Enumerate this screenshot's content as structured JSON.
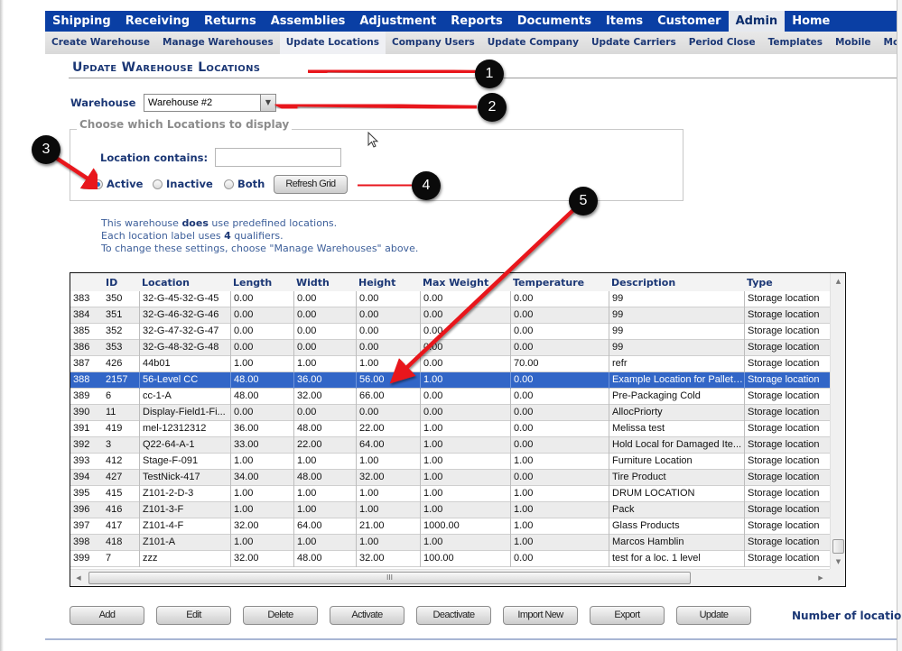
{
  "main_nav": [
    {
      "label": "Shipping",
      "active": false
    },
    {
      "label": "Receiving",
      "active": false
    },
    {
      "label": "Returns",
      "active": false
    },
    {
      "label": "Assemblies",
      "active": false
    },
    {
      "label": "Adjustment",
      "active": false
    },
    {
      "label": "Reports",
      "active": false
    },
    {
      "label": "Documents",
      "active": false
    },
    {
      "label": "Items",
      "active": false
    },
    {
      "label": "Customer",
      "active": false
    },
    {
      "label": "Admin",
      "active": true
    },
    {
      "label": "Home",
      "active": false
    }
  ],
  "sub_nav": [
    {
      "label": "Create Warehouse",
      "active": false
    },
    {
      "label": "Manage Warehouses",
      "active": false
    },
    {
      "label": "Update Locations",
      "active": true
    },
    {
      "label": "Company Users",
      "active": false
    },
    {
      "label": "Update Company",
      "active": false
    },
    {
      "label": "Update Carriers",
      "active": false
    },
    {
      "label": "Period Close",
      "active": false
    },
    {
      "label": "Templates",
      "active": false
    },
    {
      "label": "Mobile",
      "active": false
    },
    {
      "label": "Movab",
      "active": false
    }
  ],
  "page_title": "Update Warehouse Locations",
  "warehouse": {
    "label": "Warehouse",
    "selected": "Warehouse #2",
    "dropdown_glyph": "▼"
  },
  "filter": {
    "legend": "Choose which Locations to display",
    "location_contains_label": "Location contains:",
    "location_contains_value": "",
    "radios": [
      {
        "label": "Active",
        "checked": true
      },
      {
        "label": "Inactive",
        "checked": false
      },
      {
        "label": "Both",
        "checked": false
      }
    ],
    "refresh_label": "Refresh Grid"
  },
  "info": {
    "line1_pre": "This warehouse ",
    "line1_bold": "does",
    "line1_post": " use predefined locations.",
    "line2_pre": "Each location label uses ",
    "line2_bold": "4",
    "line2_post": " qualifiers.",
    "line3": "To change these settings, choose \"Manage Warehouses\" above."
  },
  "grid": {
    "columns": [
      "",
      "ID",
      "Location",
      "Length",
      "Width",
      "Height",
      "Max Weight",
      "Temperature",
      "Description",
      "Type"
    ],
    "selected_row_index": 5,
    "rows": [
      [
        "383",
        "350",
        "32-G-45-32-G-45",
        "0.00",
        "0.00",
        "0.00",
        "0.00",
        "0.00",
        "99",
        "Storage location"
      ],
      [
        "384",
        "351",
        "32-G-46-32-G-46",
        "0.00",
        "0.00",
        "0.00",
        "0.00",
        "0.00",
        "99",
        "Storage location"
      ],
      [
        "385",
        "352",
        "32-G-47-32-G-47",
        "0.00",
        "0.00",
        "0.00",
        "0.00",
        "0.00",
        "99",
        "Storage location"
      ],
      [
        "386",
        "353",
        "32-G-48-32-G-48",
        "0.00",
        "0.00",
        "0.00",
        "0.00",
        "0.00",
        "99",
        "Storage location"
      ],
      [
        "387",
        "426",
        "44b01",
        "1.00",
        "1.00",
        "1.00",
        "0.00",
        "70.00",
        "refr",
        "Storage location"
      ],
      [
        "388",
        "2157",
        "56-Level CC",
        "48.00",
        "36.00",
        "56.00",
        "1.00",
        "0.00",
        "Example Location for Pallet ...",
        "Storage location"
      ],
      [
        "389",
        "6",
        "cc-1-A",
        "48.00",
        "32.00",
        "66.00",
        "0.00",
        "0.00",
        "Pre-Packaging Cold",
        "Storage location"
      ],
      [
        "390",
        "11",
        "Display-Field1-Fi...",
        "0.00",
        "0.00",
        "0.00",
        "0.00",
        "0.00",
        "AllocPriorty",
        "Storage location"
      ],
      [
        "391",
        "419",
        "mel-12312312",
        "36.00",
        "48.00",
        "22.00",
        "1.00",
        "0.00",
        "Melissa test",
        "Storage location"
      ],
      [
        "392",
        "3",
        "Q22-64-A-1",
        "33.00",
        "22.00",
        "64.00",
        "1.00",
        "0.00",
        "Hold Local for Damaged Ite...",
        "Storage location"
      ],
      [
        "393",
        "412",
        "Stage-F-091",
        "1.00",
        "1.00",
        "1.00",
        "1.00",
        "1.00",
        "Furniture Location",
        "Storage location"
      ],
      [
        "394",
        "427",
        "TestNick-417",
        "34.00",
        "48.00",
        "32.00",
        "1.00",
        "0.00",
        "Tire Product",
        "Storage location"
      ],
      [
        "395",
        "415",
        "Z101-2-D-3",
        "1.00",
        "1.00",
        "1.00",
        "1.00",
        "1.00",
        "DRUM LOCATION",
        "Storage location"
      ],
      [
        "396",
        "416",
        "Z101-3-F",
        "1.00",
        "1.00",
        "1.00",
        "1.00",
        "1.00",
        "Pack",
        "Storage location"
      ],
      [
        "397",
        "417",
        "Z101-4-F",
        "32.00",
        "64.00",
        "21.00",
        "1000.00",
        "1.00",
        "Glass Products",
        "Storage location"
      ],
      [
        "398",
        "418",
        "Z101-A",
        "1.00",
        "1.00",
        "1.00",
        "1.00",
        "1.00",
        "Marcos Hamblin",
        "Storage location"
      ],
      [
        "399",
        "7",
        "zzz",
        "32.00",
        "48.00",
        "32.00",
        "100.00",
        "0.00",
        "test for a loc. 1 level",
        "Storage location"
      ]
    ],
    "scroll_up_glyph": "▲",
    "scroll_down_glyph": "▼",
    "scroll_left_glyph": "◀",
    "scroll_right_glyph": "▶",
    "hthumb_grip": "III"
  },
  "actions": [
    {
      "id": "add",
      "label": "Add"
    },
    {
      "id": "edit",
      "label": "Edit"
    },
    {
      "id": "delete",
      "label": "Delete"
    },
    {
      "id": "activate",
      "label": "Activate"
    },
    {
      "id": "deactivate",
      "label": "Deactivate"
    },
    {
      "id": "import-new",
      "label": "Import New"
    },
    {
      "id": "export",
      "label": "Export"
    },
    {
      "id": "update",
      "label": "Update"
    }
  ],
  "number_of_locations_label": "Number of locatio",
  "annotations": {
    "arrow_color": "#e8191a",
    "badges": [
      "1",
      "2",
      "3",
      "4",
      "5"
    ]
  }
}
